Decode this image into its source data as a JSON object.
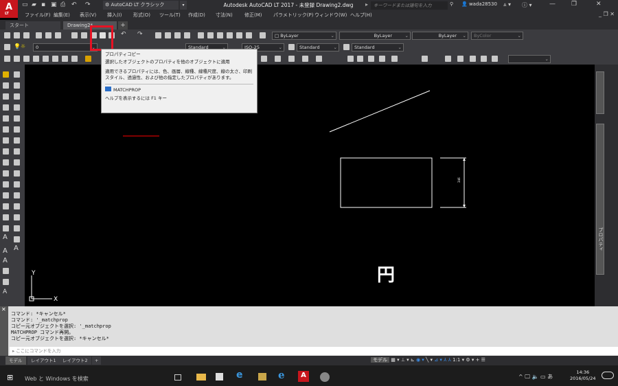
{
  "app": {
    "logo": "A",
    "logo_sub": "LT",
    "workspace": "AutoCAD LT クラシック",
    "title": "Autodesk AutoCAD LT 2017 - 未登録   Drawing2.dwg",
    "search_placeholder": "キーワードまたは語句を入力",
    "user": "wada28530"
  },
  "menu": [
    "ファイル(F)",
    "編集(E)",
    "表示(V)",
    "挿入(I)",
    "形式(O)",
    "ツール(T)",
    "作成(D)",
    "寸法(N)",
    "修正(M)",
    "パラメトリック(P)",
    "ウィンドウ(W)",
    "ヘルプ(H)"
  ],
  "tabs": [
    {
      "label": "スタート"
    },
    {
      "label": "Drawing2*"
    }
  ],
  "toolbar": {
    "layer_value": "0",
    "color": "ByLayer",
    "linetype": "ByLayer",
    "lineweight": "ByLayer",
    "plotstyle": "ByColor",
    "textstyle": "Standard",
    "dimscale": "ISO-25",
    "dimstyle": "Standard",
    "tablestyle": "Standard",
    "mleaderstyle": "Standard"
  },
  "tooltip": {
    "title": "プロパティコピー",
    "desc": "選択したオブジェクトのプロパティを他のオブジェクトに適用",
    "detail": "適用できるプロパティには、色、画層、線種、線種尺度、線の太さ、印刷スタイル、透過性、および他の指定したプロパティがあります。",
    "command": "MATCHPROP",
    "help": "ヘルプを表示するには F1 キー"
  },
  "canvas": {
    "text_en": "円",
    "dim_text": "346",
    "ucs_y": "Y",
    "ucs_x": "X"
  },
  "command": {
    "history": [
      "コマンド: *キャンセル*",
      "コマンド: '_matchprop",
      "コピー元オブジェクトを選択: '_matchprop",
      "MATCHPROP コマンド再開。",
      "コピー元オブジェクトを選択: *キャンセル*"
    ],
    "placeholder": "ここにコマンドを入力"
  },
  "layouts": [
    "モデル",
    "レイアウト1",
    "レイアウト2"
  ],
  "status": {
    "model": "モデル",
    "scale": "1:1"
  },
  "palette": {
    "label": "プロパティ"
  },
  "taskbar": {
    "search": "Web と Windows を検索",
    "time": "14:36",
    "date": "2016/05/24",
    "ime": "あ"
  },
  "colors": {
    "accent": "#c8161d",
    "highlight": "#e81123",
    "canvas": "#000000",
    "red_line": "#cc0000"
  }
}
